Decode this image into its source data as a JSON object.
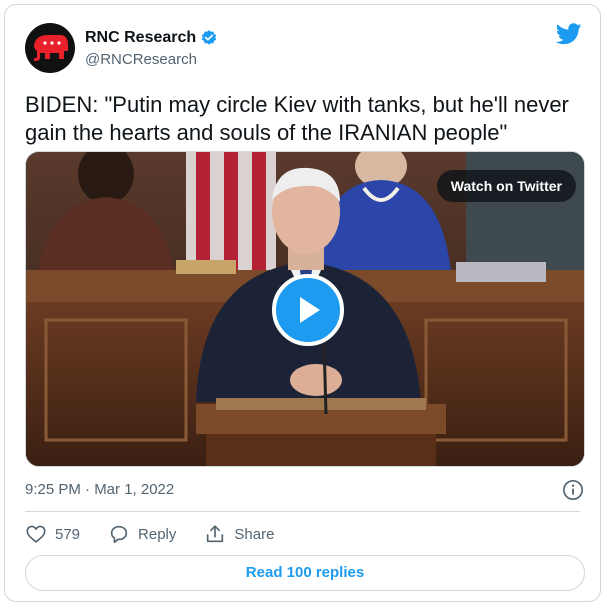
{
  "account": {
    "name": "RNC Research",
    "handle": "@RNCResearch",
    "verified": true
  },
  "tweet": {
    "text": "BIDEN: \"Putin may circle Kiev with tanks, but he'll never gain the hearts and souls of the IRANIAN people\"",
    "timestamp": "9:25 PM · Mar 1, 2022"
  },
  "media": {
    "watch_label": "Watch on Twitter"
  },
  "actions": {
    "likes_count": "579",
    "reply_label": "Reply",
    "share_label": "Share"
  },
  "footer": {
    "read_replies_label": "Read 100 replies"
  },
  "colors": {
    "accent": "#1d9bf0",
    "text": "#0f1419",
    "muted": "#536471",
    "border": "#cfd9de",
    "gop_red": "#e8212b"
  },
  "icons": {
    "brand": "twitter-bird-icon",
    "verified": "verified-badge-icon",
    "play": "play-icon",
    "info": "info-icon",
    "like": "heart-icon",
    "reply": "reply-bubble-icon",
    "share": "share-icon"
  }
}
